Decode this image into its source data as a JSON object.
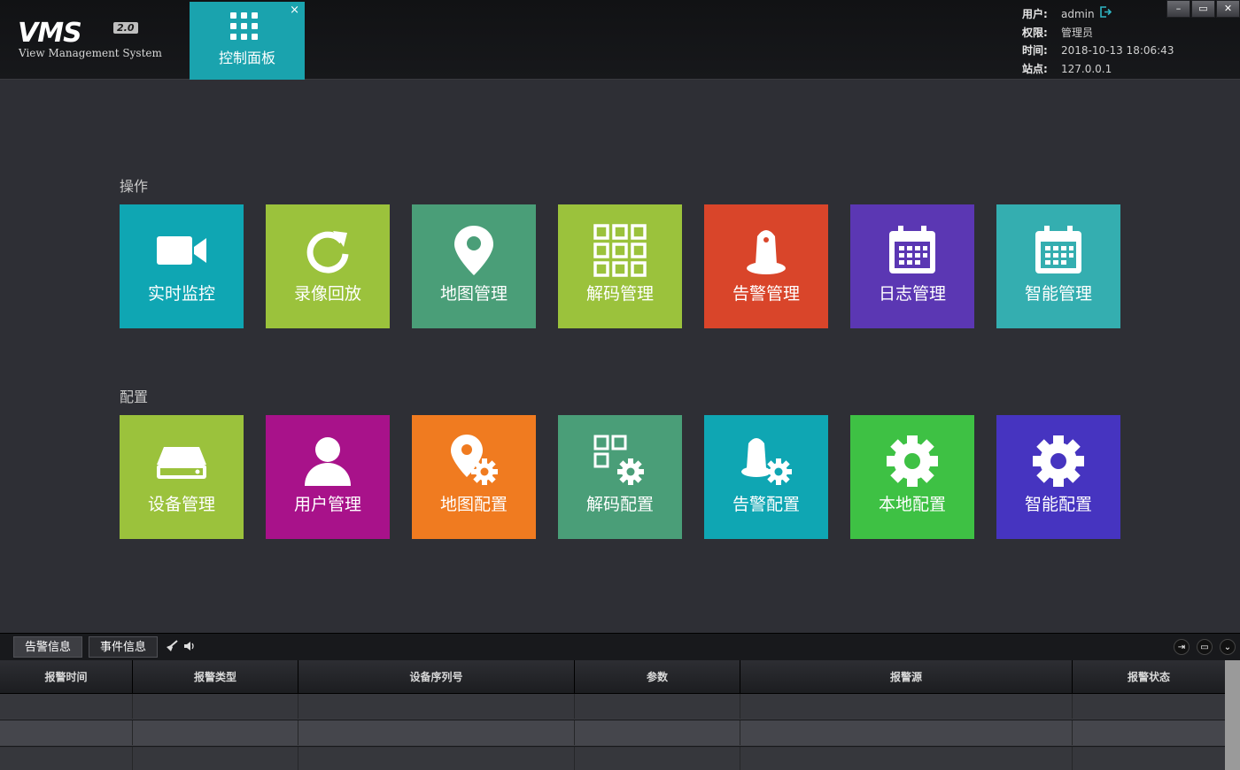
{
  "header": {
    "logo": {
      "title": "VMS",
      "version": "2.0",
      "subtitle": "View Management System"
    },
    "tab": {
      "label": "控制面板",
      "close": "×"
    },
    "info": {
      "user_key": "用户:",
      "user_val": "admin",
      "role_key": "权限:",
      "role_val": "管理员",
      "time_key": "时间:",
      "time_val": "2018-10-13 18:06:43",
      "site_key": "站点:",
      "site_val": "127.0.0.1"
    },
    "window": {
      "minimize": "–",
      "maximize": "▭",
      "close": "✕"
    }
  },
  "sections": {
    "ops": {
      "title": "操作",
      "tiles": [
        {
          "label": "实时监控",
          "color": "#0fa6b3",
          "icon": "video-camera-icon"
        },
        {
          "label": "录像回放",
          "color": "#9bc23c",
          "icon": "refresh-icon"
        },
        {
          "label": "地图管理",
          "color": "#4a9e78",
          "icon": "map-pin-icon"
        },
        {
          "label": "解码管理",
          "color": "#9bc23c",
          "icon": "grid-icon"
        },
        {
          "label": "告警管理",
          "color": "#d9452a",
          "icon": "alarm-bell-icon"
        },
        {
          "label": "日志管理",
          "color": "#5b37b3",
          "icon": "calendar-icon"
        },
        {
          "label": "智能管理",
          "color": "#34aeb0",
          "icon": "calendar-icon"
        }
      ]
    },
    "cfg": {
      "title": "配置",
      "tiles": [
        {
          "label": "设备管理",
          "color": "#9bc23c",
          "icon": "device-icon"
        },
        {
          "label": "用户管理",
          "color": "#a8128a",
          "icon": "user-icon"
        },
        {
          "label": "地图配置",
          "color": "#f07b20",
          "icon": "map-pin-gear-icon"
        },
        {
          "label": "解码配置",
          "color": "#4a9e78",
          "icon": "grid-gear-icon"
        },
        {
          "label": "告警配置",
          "color": "#0fa6b3",
          "icon": "alarm-gear-icon"
        },
        {
          "label": "本地配置",
          "color": "#3ec144",
          "icon": "gear-icon"
        },
        {
          "label": "智能配置",
          "color": "#4634c0",
          "icon": "gear-icon"
        }
      ]
    }
  },
  "bottom": {
    "tabs": [
      "告警信息",
      "事件信息"
    ],
    "columns": [
      "报警时间",
      "报警类型",
      "设备序列号",
      "参数",
      "报警源",
      "报警状态"
    ]
  }
}
